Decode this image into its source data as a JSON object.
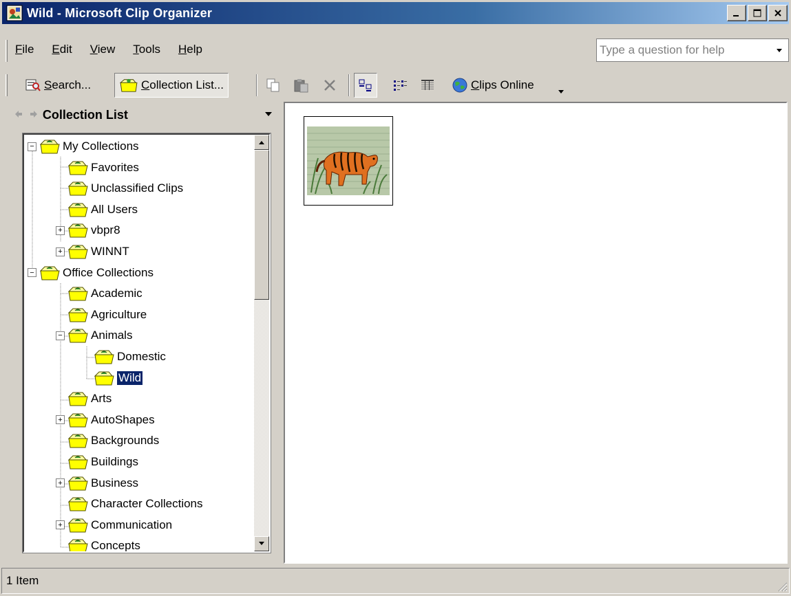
{
  "window": {
    "title": "Wild - Microsoft Clip Organizer",
    "icon": "clip-organizer-app-icon",
    "controls": [
      "minimize-icon",
      "maximize-icon",
      "close-icon"
    ]
  },
  "menubar": {
    "items": [
      {
        "label": "File",
        "key": "F",
        "rest": "ile"
      },
      {
        "label": "Edit",
        "key": "E",
        "rest": "dit"
      },
      {
        "label": "View",
        "key": "V",
        "rest": "iew"
      },
      {
        "label": "Tools",
        "key": "T",
        "rest": "ools"
      },
      {
        "label": "Help",
        "key": "H",
        "rest": "elp"
      }
    ],
    "help_placeholder": "Type a question for help"
  },
  "toolbar": {
    "search": {
      "key": "S",
      "rest": "earch..."
    },
    "collection_list": {
      "key": "C",
      "rest": "ollection List..."
    },
    "clips_online": {
      "key": "C",
      "rest": "lips Online"
    },
    "icons": [
      "copy-icon",
      "paste-icon",
      "delete-icon",
      "thumbnails-view-icon",
      "list-view-icon",
      "details-view-icon",
      "globe-icon"
    ]
  },
  "task_pane": {
    "title": "Collection List"
  },
  "tree": {
    "items": [
      {
        "label": "My Collections",
        "expander": "−"
      },
      {
        "label": "Favorites"
      },
      {
        "label": "Unclassified Clips"
      },
      {
        "label": "All Users"
      },
      {
        "label": "vbpr8",
        "expander": "+"
      },
      {
        "label": "WINNT",
        "expander": "+"
      },
      {
        "label": "Office Collections",
        "expander": "−"
      },
      {
        "label": "Academic"
      },
      {
        "label": "Agriculture"
      },
      {
        "label": "Animals",
        "expander": "−"
      },
      {
        "label": "Domestic"
      },
      {
        "label": "Wild",
        "selected": true
      },
      {
        "label": "Arts"
      },
      {
        "label": "AutoShapes",
        "expander": "+"
      },
      {
        "label": "Backgrounds"
      },
      {
        "label": "Buildings"
      },
      {
        "label": "Business",
        "expander": "+"
      },
      {
        "label": "Character Collections"
      },
      {
        "label": "Communication",
        "expander": "+"
      },
      {
        "label": "Concepts"
      }
    ]
  },
  "main": {
    "clips": [
      {
        "name": "tiger-clip",
        "icon": "tiger-clipart-thumbnail"
      }
    ]
  },
  "statusbar": {
    "text": "1 Item"
  },
  "colors": {
    "titlebar_start": "#0a246a",
    "titlebar_end": "#a6caf0",
    "selection": "#0a246a",
    "face": "#d4d0c8"
  }
}
